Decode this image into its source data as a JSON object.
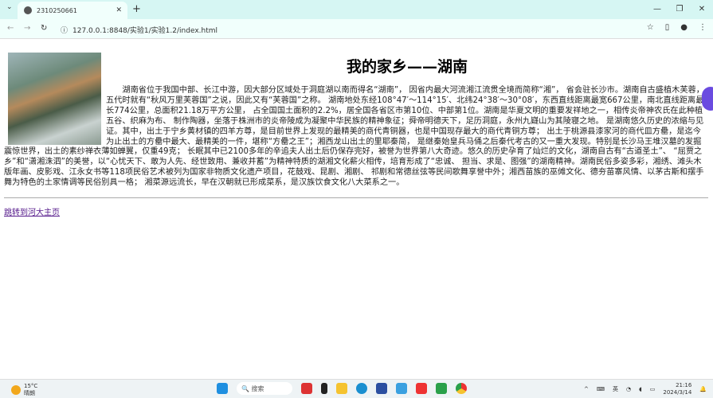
{
  "browser": {
    "tab_title": "2310250661",
    "url": "127.0.0.1:8848/实验1/实验1.2/index.html"
  },
  "page": {
    "title": "我的家乡——湖南",
    "paragraph": "湖南省位于我国中部、长江中游，因大部分区域处于洞庭湖以南而得名“湖南”， 因省内最大河流湘江流贯全境而简称“湘”， 省会驻长沙市。湖南自古盛植木芙蓉，五代时就有“秋风万里芙蓉国”之说，因此又有“芙蓉国”之称。 湖南地处东经108°47′～114°15′、北纬24°38′～30°08′，东西直线距离最宽667公里，南北直线距离最长774公里，总面积21.18万平方公里， 占全国国土面积的2.2%，居全国各省区市第10位、中部第1位。湖南是华夏文明的重要发祥地之一，相传炎帝神农氏在此种植五谷、织麻为布、 制作陶器，坐落于株洲市的炎帝陵成为凝聚中华民族的精神象征；舜帝明德天下，足历洞庭，永州九嶷山为其陵寝之地。 是湖南悠久历史的浓缩与见证。其中，出土于宁乡黄材镇的四羊方尊，是目前世界上发现的最精美的商代青铜器，也是中国现存最大的商代青铜方尊； 出土于桃源县漆家河的商代皿方罍，是迄今为止出土的方罍中最大、最精美的一件，堪称“方罍之王”；湘西龙山出土的里耶秦简， 是继秦始皇兵马俑之后秦代考古的又一重大发现。特别是长沙马王堆汉墓的发掘震惊世界，出土的素纱禅衣薄如蝉翼，仅重49克； 长眠其中已2100多年的辛追夫人出土后仍保存完好，被誉为世界第八大奇迹。悠久的历史孕育了灿烂的文化，湖南自古有“古道圣土”、 “屈贾之乡”和“潇湘洙泗”的美誉，以“心忧天下、敢为人先、经世致用、兼收并蓄”为精神特质的湖湘文化薪火相传，培育形成了“忠诚、 担当、求是、图强”的湖南精神。湖南民俗多姿多彩，湘绣、滩头木版年画、皮影戏、江永女书等118项民俗艺术被列为国家非物质文化遗产项目，花鼓戏、昆剧、湘剧、 祁剧和常德丝弦等民间歌舞享誉中外；湘西苗族的巫傩文化、德夯苗寨风情、以茅古斯和摆手舞为特色的土家情调等民俗别具一格； 湘菜源远流长，早在汉朝就已形成菜系，是汉族饮食文化八大菜系之一。",
    "link": "跳转到河大主页"
  },
  "taskbar": {
    "temperature": "15°C",
    "weather": "晴朗",
    "search_placeholder": "搜索",
    "time": "21:16",
    "date": "2024/3/14"
  }
}
